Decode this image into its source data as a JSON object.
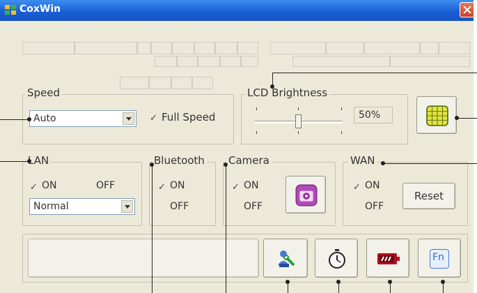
{
  "window": {
    "title": "CoxWin",
    "app_icon": "app-icon",
    "close_icon": "close-icon"
  },
  "speed": {
    "label": "Speed",
    "selected": "Auto",
    "full_speed_label": "Full Speed",
    "full_speed_checked": true
  },
  "lcd": {
    "label": "LCD Brightness",
    "value": "50%",
    "level": 0.5,
    "grid_icon": "grid-icon"
  },
  "lan": {
    "label": "LAN",
    "on_label": "ON",
    "off_label": "OFF",
    "on_checked": true,
    "off_checked": false,
    "mode": "Normal"
  },
  "bluetooth": {
    "label": "Bluetooth",
    "on_label": "ON",
    "off_label": "OFF",
    "on_checked": true,
    "off_checked": false
  },
  "camera": {
    "label": "Camera",
    "on_label": "ON",
    "off_label": "OFF",
    "on_checked": true,
    "off_checked": false,
    "camera_icon": "camera-icon"
  },
  "wan": {
    "label": "WAN",
    "on_label": "ON",
    "off_label": "OFF",
    "on_checked": true,
    "off_checked": false,
    "reset_label": "Reset"
  },
  "toolbar": {
    "icons": [
      "search-user-icon",
      "stopwatch-icon",
      "battery-icon",
      "fn-key-icon"
    ],
    "fn_label": "Fn"
  },
  "colors": {
    "title_bar": "#1a5fd6",
    "face": "#ece9d8",
    "grid_yellow": "#e8e23a",
    "camera_purple": "#b04ab8",
    "battery_red": "#b01020"
  }
}
